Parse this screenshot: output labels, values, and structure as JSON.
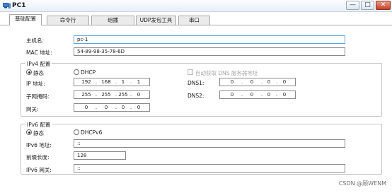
{
  "window": {
    "title": "PC1",
    "minimize_label": "—",
    "maximize_label": "□",
    "close_label": "✕"
  },
  "tabs": [
    "基础配置",
    "命令行",
    "组播",
    "UDP发包工具",
    "串口"
  ],
  "basic": {
    "hostname_label": "主机名:",
    "hostname_value": "pc-1",
    "mac_label": "MAC 地址:",
    "mac_value": "54-89-98-35-78-6D"
  },
  "ipv4": {
    "group_title": "IPv4 配置",
    "static_label": "静态",
    "dhcp_label": "DHCP",
    "auto_dns_label": "自动获取 DNS 服务器地址",
    "ip_label": "IP 地址:",
    "ip_value": [
      "192",
      "168",
      "1",
      "1"
    ],
    "mask_label": "子网掩码:",
    "mask_value": [
      "255",
      "255",
      "255",
      "0"
    ],
    "gateway_label": "网关:",
    "gateway_value": [
      "0",
      "0",
      "0",
      "0"
    ],
    "dns1_label": "DNS1:",
    "dns1_value": [
      "0",
      "0",
      "0",
      "0"
    ],
    "dns2_label": "DNS2:",
    "dns2_value": [
      "0",
      "0",
      "0",
      "0"
    ],
    "static_selected": true
  },
  "ipv6": {
    "group_title": "IPv6 配置",
    "static_label": "静态",
    "dhcpv6_label": "DHCPv6",
    "address_label": "IPv6 地址:",
    "address_value": "::",
    "prefix_label": "前缀长度:",
    "prefix_value": "128",
    "gateway_label": "IPv6 网关:",
    "gateway_value": "::",
    "static_selected": true
  },
  "watermark": "CSDN @顾WENM"
}
